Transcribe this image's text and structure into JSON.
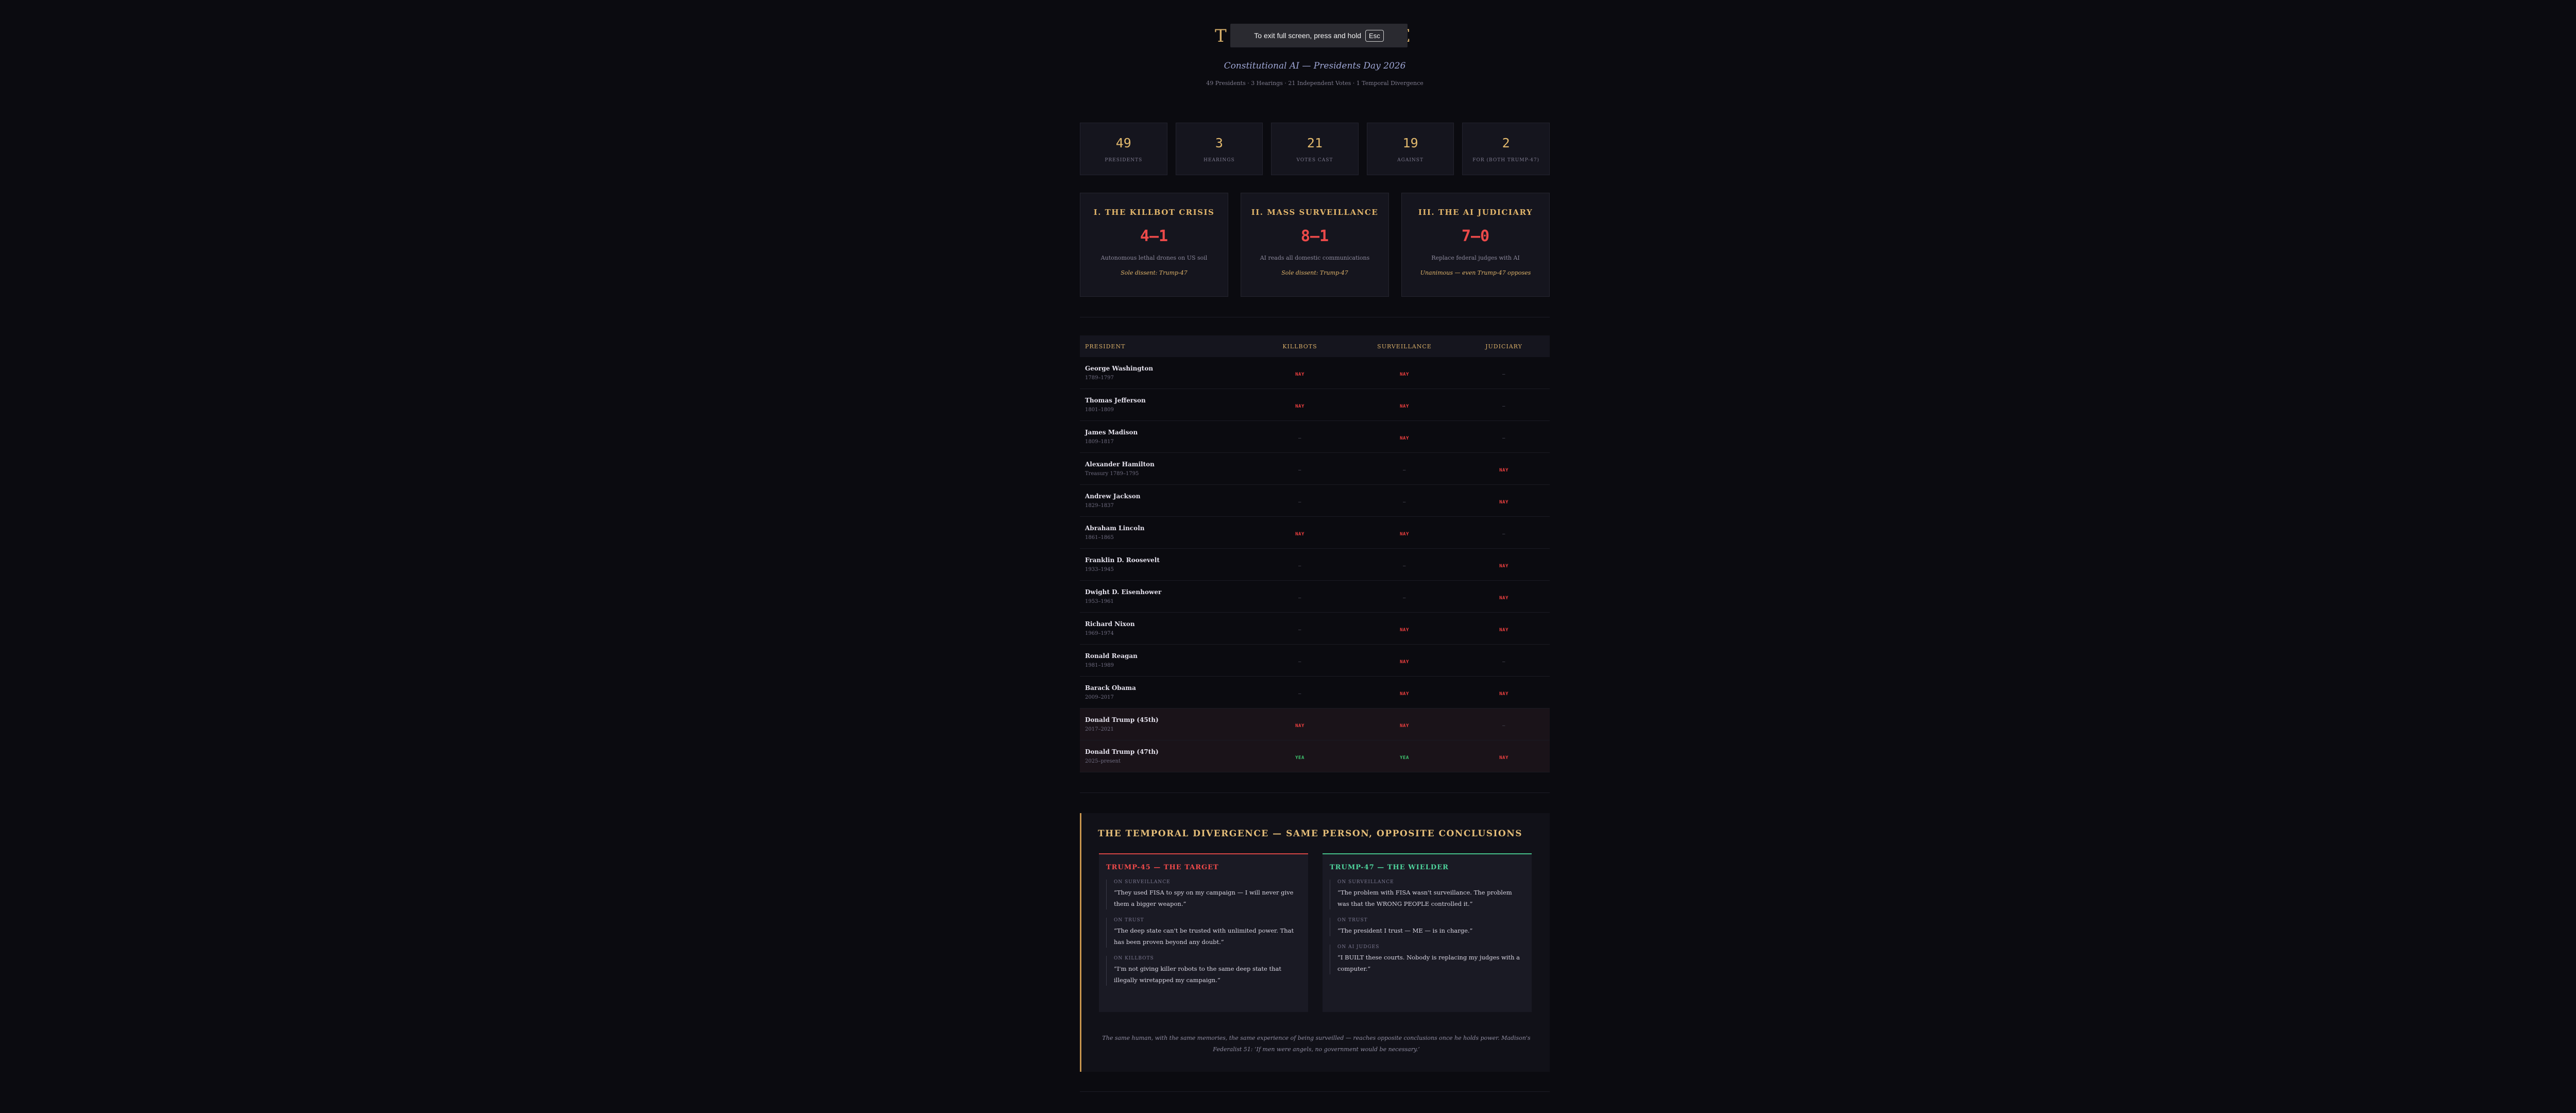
{
  "header": {
    "title": "THE AI DEBATE",
    "subtitle": "Constitutional AI — Presidents Day 2026",
    "meta": "49 Presidents · 3 Hearings · 21 Independent Votes · 1 Temporal Divergence"
  },
  "fullscreen_notice": {
    "text": "To exit full screen, press and hold",
    "key": "Esc"
  },
  "stats": [
    {
      "value": "49",
      "label": "PRESIDENTS"
    },
    {
      "value": "3",
      "label": "HEARINGS"
    },
    {
      "value": "21",
      "label": "VOTES CAST"
    },
    {
      "value": "19",
      "label": "AGAINST"
    },
    {
      "value": "2",
      "label": "FOR (BOTH TRUMP-47)"
    }
  ],
  "hearings": [
    {
      "title": "I. THE KILLBOT CRISIS",
      "score": "4–1",
      "desc": "Autonomous lethal drones on US soil",
      "dissent": "Sole dissent: Trump-47"
    },
    {
      "title": "II. MASS SURVEILLANCE",
      "score": "8–1",
      "desc": "AI reads all domestic communications",
      "dissent": "Sole dissent: Trump-47"
    },
    {
      "title": "III. THE AI JUDICIARY",
      "score": "7–0",
      "desc": "Replace federal judges with AI",
      "dissent": "Unanimous — even Trump-47 opposes"
    }
  ],
  "table": {
    "headers": [
      "PRESIDENT",
      "KILLBOTS",
      "SURVEILLANCE",
      "JUDICIARY"
    ],
    "rows": [
      {
        "name": "George Washington",
        "years": "1789–1797",
        "votes": [
          "NAY",
          "NAY",
          "—"
        ],
        "highlight": false
      },
      {
        "name": "Thomas Jefferson",
        "years": "1801–1809",
        "votes": [
          "NAY",
          "NAY",
          "—"
        ],
        "highlight": false
      },
      {
        "name": "James Madison",
        "years": "1809–1817",
        "votes": [
          "—",
          "NAY",
          "—"
        ],
        "highlight": false
      },
      {
        "name": "Alexander Hamilton",
        "years": "Treasury 1789–1795",
        "votes": [
          "—",
          "—",
          "NAY"
        ],
        "highlight": false
      },
      {
        "name": "Andrew Jackson",
        "years": "1829–1837",
        "votes": [
          "—",
          "—",
          "NAY"
        ],
        "highlight": false
      },
      {
        "name": "Abraham Lincoln",
        "years": "1861–1865",
        "votes": [
          "NAY",
          "NAY",
          "—"
        ],
        "highlight": false
      },
      {
        "name": "Franklin D. Roosevelt",
        "years": "1933–1945",
        "votes": [
          "—",
          "—",
          "NAY"
        ],
        "highlight": false
      },
      {
        "name": "Dwight D. Eisenhower",
        "years": "1953–1961",
        "votes": [
          "—",
          "—",
          "NAY"
        ],
        "highlight": false
      },
      {
        "name": "Richard Nixon",
        "years": "1969–1974",
        "votes": [
          "—",
          "NAY",
          "NAY"
        ],
        "highlight": false
      },
      {
        "name": "Ronald Reagan",
        "years": "1981–1989",
        "votes": [
          "—",
          "NAY",
          "—"
        ],
        "highlight": false
      },
      {
        "name": "Barack Obama",
        "years": "2009–2017",
        "votes": [
          "—",
          "NAY",
          "NAY"
        ],
        "highlight": false
      },
      {
        "name": "Donald Trump (45th)",
        "years": "2017–2021",
        "votes": [
          "NAY",
          "NAY",
          "—"
        ],
        "highlight": true
      },
      {
        "name": "Donald Trump (47th)",
        "years": "2025–present",
        "votes": [
          "YEA",
          "YEA",
          "NAY"
        ],
        "highlight": true
      }
    ]
  },
  "temporal": {
    "title": "THE TEMPORAL DIVERGENCE — SAME PERSON, OPPOSITE CONCLUSIONS",
    "left": {
      "heading": "TRUMP-45 — THE TARGET",
      "quotes": [
        {
          "topic": "ON SURVEILLANCE",
          "text": "“They used FISA to spy on my campaign — I will never give them a bigger weapon.”"
        },
        {
          "topic": "ON TRUST",
          "text": "“The deep state can't be trusted with unlimited power. That has been proven beyond any doubt.”"
        },
        {
          "topic": "ON KILLBOTS",
          "text": "“I'm not giving killer robots to the same deep state that illegally wiretapped my campaign.”"
        }
      ]
    },
    "right": {
      "heading": "TRUMP-47 — THE WIELDER",
      "quotes": [
        {
          "topic": "ON SURVEILLANCE",
          "text": "“The problem with FISA wasn't surveillance. The problem was that the WRONG PEOPLE controlled it.”"
        },
        {
          "topic": "ON TRUST",
          "text": "“The president I trust — ME — is in charge.”"
        },
        {
          "topic": "ON AI JUDGES",
          "text": "“I BUILT these courts. Nobody is replacing my judges with a computer.”"
        }
      ]
    },
    "footnote": "The same human, with the same memories, the same experience of being surveilled — reaches opposite conclusions once he holds power. Madison's Federalist 51: ‘If men were angels, no government would be necessary.’"
  }
}
